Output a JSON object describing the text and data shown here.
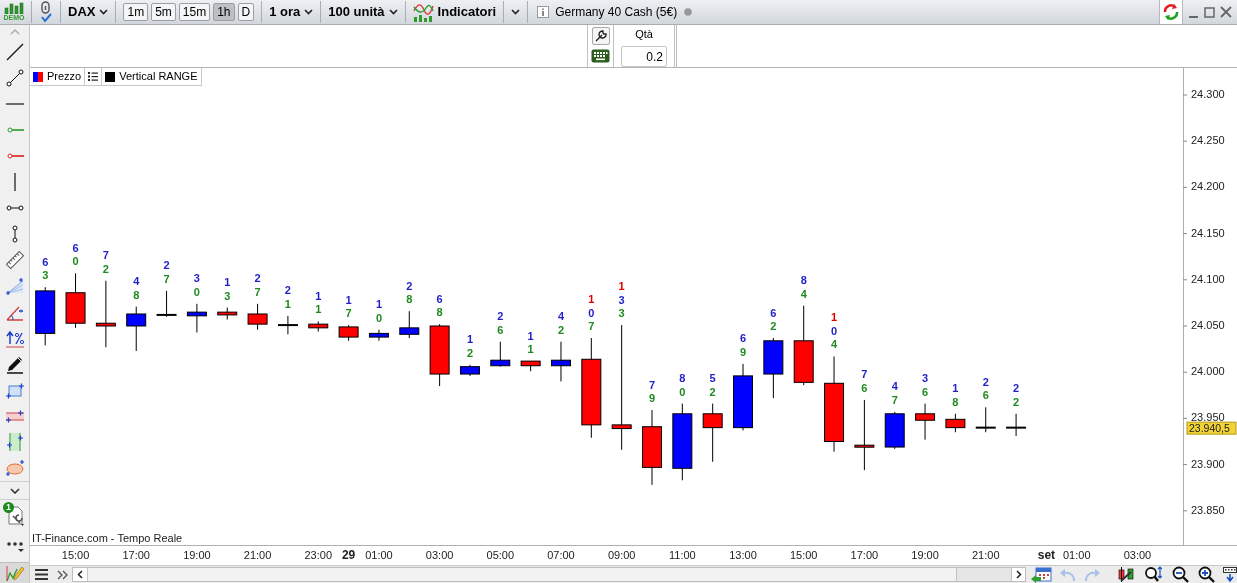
{
  "toolbar": {
    "logo_text": "DEMO",
    "symbol": "DAX",
    "timeframes": [
      {
        "label": "1m",
        "selected": false
      },
      {
        "label": "5m",
        "selected": false
      },
      {
        "label": "15m",
        "selected": false
      },
      {
        "label": "1h",
        "selected": true
      },
      {
        "label": "D",
        "selected": false
      }
    ],
    "period": "1 ora",
    "units": "100 unità",
    "indicators": "Indicatori",
    "instrument": "Germany 40 Cash (5€)"
  },
  "order_panel": {
    "qty_label": "Qtà",
    "qty_value": "0.2"
  },
  "legend": [
    {
      "kind": "price",
      "label": "Prezzo"
    },
    {
      "kind": "list"
    },
    {
      "kind": "series",
      "label": "Vertical RANGE",
      "color": "#000000"
    }
  ],
  "left_toolbar": {
    "badge": "1"
  },
  "chart": {
    "source": "IT-Finance.com - Tempo Reale",
    "last_price": "23.940,5",
    "price_axis_labels": [
      "24.300",
      "24.250",
      "24.200",
      "24.150",
      "24.100",
      "24.050",
      "24.000",
      "23.950",
      "23.900",
      "23.850"
    ],
    "time_axis_labels": [
      "15:00",
      "17:00",
      "19:00",
      "21:00",
      "23:00",
      "29",
      "01:00",
      "03:00",
      "05:00",
      "07:00",
      "09:00",
      "11:00",
      "13:00",
      "15:00",
      "17:00",
      "19:00",
      "21:00",
      "set",
      "01:00",
      "03:00"
    ],
    "candle_labels": [
      {
        "digits": [
          {
            "text": "6",
            "color": "#1f1fc8"
          },
          {
            "text": "3",
            "color": "#1e8a1e"
          }
        ]
      },
      {
        "digits": [
          {
            "text": "6",
            "color": "#1f1fc8"
          },
          {
            "text": "0",
            "color": "#1e8a1e"
          }
        ]
      },
      {
        "digits": [
          {
            "text": "7",
            "color": "#1f1fc8"
          },
          {
            "text": "2",
            "color": "#1e8a1e"
          }
        ]
      },
      {
        "digits": [
          {
            "text": "4",
            "color": "#1f1fc8"
          },
          {
            "text": "8",
            "color": "#1e8a1e"
          }
        ]
      },
      {
        "digits": [
          {
            "text": "2",
            "color": "#1f1fc8"
          },
          {
            "text": "7",
            "color": "#1e8a1e"
          }
        ]
      },
      {
        "digits": [
          {
            "text": "3",
            "color": "#1f1fc8"
          },
          {
            "text": "0",
            "color": "#1e8a1e"
          }
        ]
      },
      {
        "digits": [
          {
            "text": "1",
            "color": "#1f1fc8"
          },
          {
            "text": "3",
            "color": "#1e8a1e"
          }
        ]
      },
      {
        "digits": [
          {
            "text": "2",
            "color": "#1f1fc8"
          },
          {
            "text": "7",
            "color": "#1e8a1e"
          }
        ]
      },
      {
        "digits": [
          {
            "text": "2",
            "color": "#1f1fc8"
          },
          {
            "text": "1",
            "color": "#1e8a1e"
          }
        ]
      },
      {
        "digits": [
          {
            "text": "1",
            "color": "#1f1fc8"
          },
          {
            "text": "1",
            "color": "#1e8a1e"
          }
        ]
      },
      {
        "digits": [
          {
            "text": "1",
            "color": "#1f1fc8"
          },
          {
            "text": "7",
            "color": "#1e8a1e"
          }
        ]
      },
      {
        "digits": [
          {
            "text": "1",
            "color": "#1f1fc8"
          },
          {
            "text": "0",
            "color": "#1e8a1e"
          }
        ]
      },
      {
        "digits": [
          {
            "text": "2",
            "color": "#1f1fc8"
          },
          {
            "text": "8",
            "color": "#1e8a1e"
          }
        ]
      },
      {
        "digits": [
          {
            "text": "6",
            "color": "#1f1fc8"
          },
          {
            "text": "8",
            "color": "#1e8a1e"
          }
        ]
      },
      {
        "digits": [
          {
            "text": "1",
            "color": "#1f1fc8"
          },
          {
            "text": "2",
            "color": "#1e8a1e"
          }
        ]
      },
      {
        "digits": [
          {
            "text": "2",
            "color": "#1f1fc8"
          },
          {
            "text": "6",
            "color": "#1e8a1e"
          }
        ]
      },
      {
        "digits": [
          {
            "text": "1",
            "color": "#1f1fc8"
          },
          {
            "text": "1",
            "color": "#1e8a1e"
          }
        ]
      },
      {
        "digits": [
          {
            "text": "4",
            "color": "#1f1fc8"
          },
          {
            "text": "2",
            "color": "#1e8a1e"
          }
        ]
      },
      {
        "digits": [
          {
            "text": "1",
            "color": "#e00000"
          },
          {
            "text": "0",
            "color": "#1f1fc8"
          },
          {
            "text": "7",
            "color": "#1e8a1e"
          }
        ]
      },
      {
        "digits": [
          {
            "text": "1",
            "color": "#e00000"
          },
          {
            "text": "3",
            "color": "#1f1fc8"
          },
          {
            "text": "3",
            "color": "#1e8a1e"
          }
        ]
      },
      {
        "digits": [
          {
            "text": "7",
            "color": "#1f1fc8"
          },
          {
            "text": "9",
            "color": "#1e8a1e"
          }
        ]
      },
      {
        "digits": [
          {
            "text": "8",
            "color": "#1f1fc8"
          },
          {
            "text": "0",
            "color": "#1e8a1e"
          }
        ]
      },
      {
        "digits": [
          {
            "text": "5",
            "color": "#1f1fc8"
          },
          {
            "text": "2",
            "color": "#1e8a1e"
          }
        ]
      },
      {
        "digits": [
          {
            "text": "6",
            "color": "#1f1fc8"
          },
          {
            "text": "9",
            "color": "#1e8a1e"
          }
        ]
      },
      {
        "digits": [
          {
            "text": "6",
            "color": "#1f1fc8"
          },
          {
            "text": "2",
            "color": "#1e8a1e"
          }
        ]
      },
      {
        "digits": [
          {
            "text": "8",
            "color": "#1f1fc8"
          },
          {
            "text": "4",
            "color": "#1e8a1e"
          }
        ]
      },
      {
        "digits": [
          {
            "text": "1",
            "color": "#e00000"
          },
          {
            "text": "0",
            "color": "#1f1fc8"
          },
          {
            "text": "4",
            "color": "#1e8a1e"
          }
        ]
      },
      {
        "digits": [
          {
            "text": "7",
            "color": "#1f1fc8"
          },
          {
            "text": "6",
            "color": "#1e8a1e"
          }
        ]
      },
      {
        "digits": [
          {
            "text": "4",
            "color": "#1f1fc8"
          },
          {
            "text": "7",
            "color": "#1e8a1e"
          }
        ]
      },
      {
        "digits": [
          {
            "text": "3",
            "color": "#1f1fc8"
          },
          {
            "text": "6",
            "color": "#1e8a1e"
          }
        ]
      },
      {
        "digits": [
          {
            "text": "1",
            "color": "#1f1fc8"
          },
          {
            "text": "8",
            "color": "#1e8a1e"
          }
        ]
      },
      {
        "digits": [
          {
            "text": "2",
            "color": "#1f1fc8"
          },
          {
            "text": "6",
            "color": "#1e8a1e"
          }
        ]
      },
      {
        "digits": [
          {
            "text": "2",
            "color": "#1f1fc8"
          },
          {
            "text": "2",
            "color": "#1e8a1e"
          }
        ]
      }
    ]
  },
  "bottom_bar": {
    "history_buttons": [
      {
        "kind": "undo",
        "disabled": true
      },
      {
        "kind": "redo",
        "disabled": true
      }
    ]
  }
}
